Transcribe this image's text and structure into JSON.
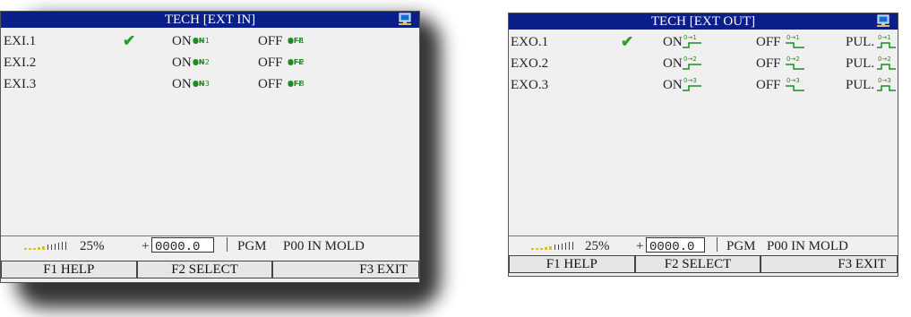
{
  "left_screen": {
    "title": "TECH [EXT IN]",
    "rows": [
      {
        "label": "EXI.1",
        "checked": true,
        "on": "ON",
        "off": "OFF",
        "num": "1"
      },
      {
        "label": "EXI.2",
        "checked": false,
        "on": "ON",
        "off": "OFF",
        "num": "2"
      },
      {
        "label": "EXI.3",
        "checked": false,
        "on": "ON",
        "off": "OFF",
        "num": "3"
      }
    ],
    "sym_on": "ON",
    "sym_off": "OFF",
    "check_mark": "✔",
    "status": {
      "percent": "25%",
      "sign": "+",
      "value": "0000.0",
      "pgm": "PGM",
      "mode": "P00 IN MOLD"
    },
    "fkeys": {
      "f1": "F1 HELP",
      "f2": "F2 SELECT",
      "f3": "F3 EXIT"
    }
  },
  "right_screen": {
    "title": "TECH [EXT OUT]",
    "rows": [
      {
        "label": "EXO.1",
        "checked": true,
        "on": "ON",
        "off": "OFF",
        "pul": "PUL.",
        "num": "1"
      },
      {
        "label": "EXO.2",
        "checked": false,
        "on": "ON",
        "off": "OFF",
        "pul": "PUL.",
        "num": "2"
      },
      {
        "label": "EXO.3",
        "checked": false,
        "on": "ON",
        "off": "OFF",
        "pul": "PUL.",
        "num": "3"
      }
    ],
    "check_mark": "✔",
    "status": {
      "percent": "25%",
      "sign": "+",
      "value": "0000.0",
      "pgm": "PGM",
      "mode": "P00 IN MOLD"
    },
    "fkeys": {
      "f1": "F1 HELP",
      "f2": "F2 SELECT",
      "f3": "F3 EXIT"
    }
  },
  "colors": {
    "titlebar": "#0b1f8a",
    "check": "#2aa02a",
    "symbol": "#1e8c1e",
    "signal_bar": "#e0c020"
  }
}
